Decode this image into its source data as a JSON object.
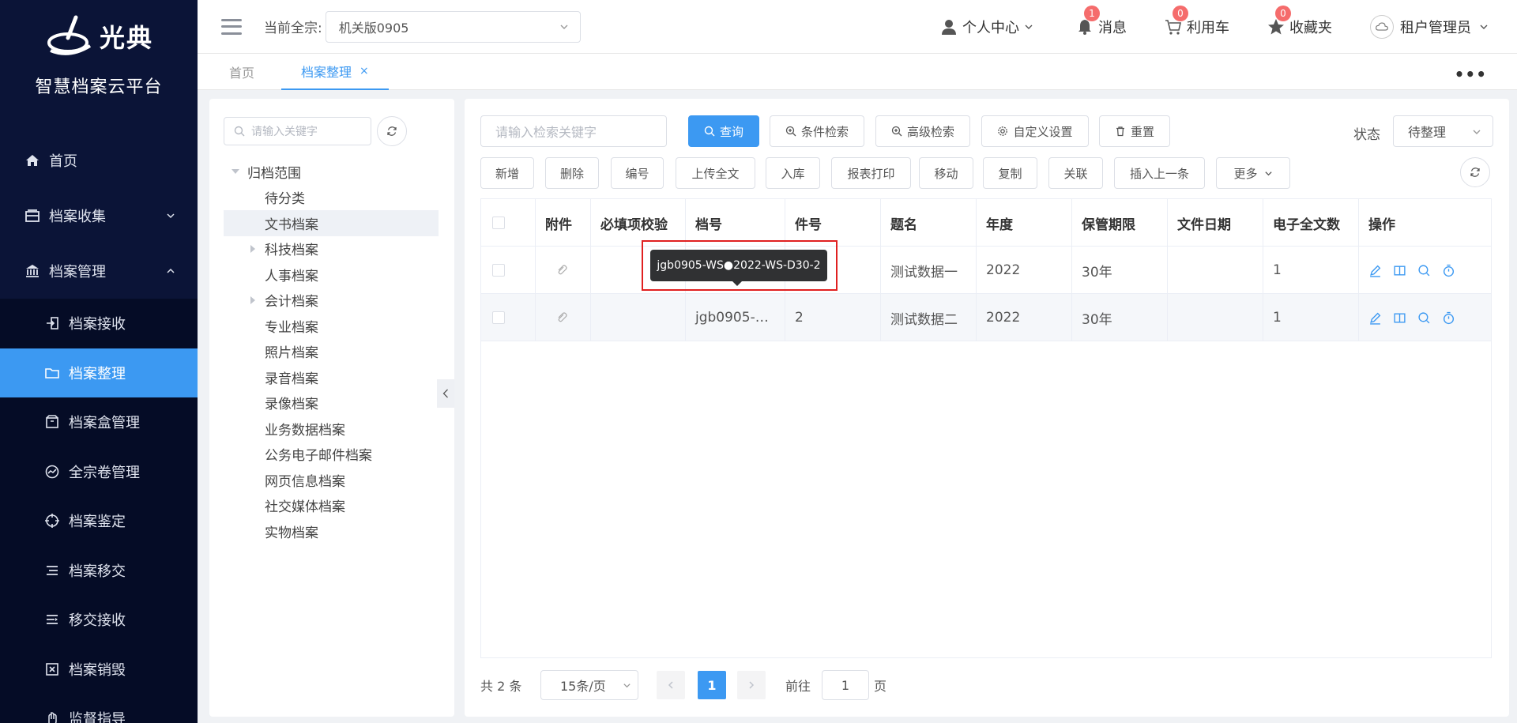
{
  "brand": {
    "logo_text": "光典",
    "platform": "智慧档案云平台"
  },
  "sidebar": {
    "items": [
      {
        "label": "首页",
        "icon": "home-icon"
      },
      {
        "label": "档案收集",
        "icon": "inbox-icon"
      },
      {
        "label": "档案管理",
        "icon": "bank-icon"
      }
    ],
    "sub_items": [
      {
        "label": "档案接收",
        "icon": "receive-icon"
      },
      {
        "label": "档案整理",
        "icon": "folder-icon",
        "active": true
      },
      {
        "label": "档案盒管理",
        "icon": "box-icon"
      },
      {
        "label": "全宗卷管理",
        "icon": "chart-icon"
      },
      {
        "label": "档案鉴定",
        "icon": "target-icon"
      },
      {
        "label": "档案移交",
        "icon": "transfer-icon"
      },
      {
        "label": "移交接收",
        "icon": "list-icon"
      },
      {
        "label": "档案销毁",
        "icon": "destroy-icon"
      },
      {
        "label": "监督指导",
        "icon": "guide-icon"
      }
    ]
  },
  "header": {
    "current_label": "当前全宗:",
    "current_value": "机关版0905",
    "user_center": "个人中心",
    "messages": {
      "label": "消息",
      "count": "1"
    },
    "cart": {
      "label": "利用车",
      "count": "0"
    },
    "favorites": {
      "label": "收藏夹",
      "count": "0"
    },
    "user": "租户管理员"
  },
  "tabs": [
    {
      "label": "首页"
    },
    {
      "label": "档案整理",
      "close": "×"
    }
  ],
  "tree": {
    "search_placeholder": "请输入关键字",
    "root": "归档范围",
    "nodes": [
      "待分类",
      "文书档案",
      "科技档案",
      "人事档案",
      "会计档案",
      "专业档案",
      "照片档案",
      "录音档案",
      "录像档案",
      "业务数据档案",
      "公务电子邮件档案",
      "网页信息档案",
      "社交媒体档案",
      "实物档案"
    ]
  },
  "toolbar": {
    "search_placeholder": "请输入检索关键字",
    "query": "查询",
    "condition_search": "条件检索",
    "advanced_search": "高级检索",
    "custom_settings": "自定义设置",
    "reset": "重置",
    "status_label": "状态",
    "status_value": "待整理",
    "actions": [
      "新增",
      "删除",
      "编号",
      "上传全文",
      "入库",
      "报表打印",
      "移动",
      "复制",
      "关联",
      "插入上一条"
    ],
    "more": "更多"
  },
  "table": {
    "headers": [
      "附件",
      "必填项校验",
      "档号",
      "件号",
      "题名",
      "年度",
      "保管期限",
      "文件日期",
      "电子全文数",
      "操作"
    ],
    "rows": [
      {
        "doc_no": "",
        "item_no": "",
        "title": "测试数据一",
        "year": "2022",
        "retention": "30年",
        "date": "",
        "count": "1"
      },
      {
        "doc_no": "jgb0905-…",
        "item_no": "2",
        "title": "测试数据二",
        "year": "2022",
        "retention": "30年",
        "date": "",
        "count": "1"
      }
    ]
  },
  "tooltip": {
    "text": "jgb0905-WS●2022-WS-D30-2"
  },
  "pager": {
    "total": "共 2 条",
    "size": "15条/页",
    "page": "1",
    "goto": "前往",
    "goto_value": "1",
    "unit": "页"
  },
  "colors": {
    "primary": "#3c99f2",
    "sidebar": "#0b1437",
    "badge": "#f56c6c",
    "highlight": "#e02020"
  }
}
